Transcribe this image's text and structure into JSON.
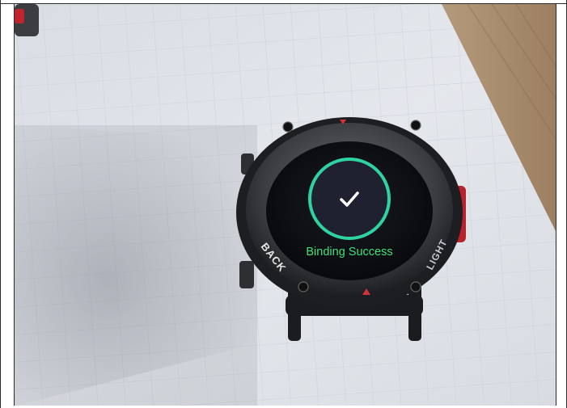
{
  "screen": {
    "status_text": "Binding Success",
    "status_icon": "check-icon",
    "ring_color": "#2fd3a2",
    "text_color": "#3ee07a"
  },
  "bezel_labels": {
    "left": "BACK",
    "right": "LIGHT"
  }
}
